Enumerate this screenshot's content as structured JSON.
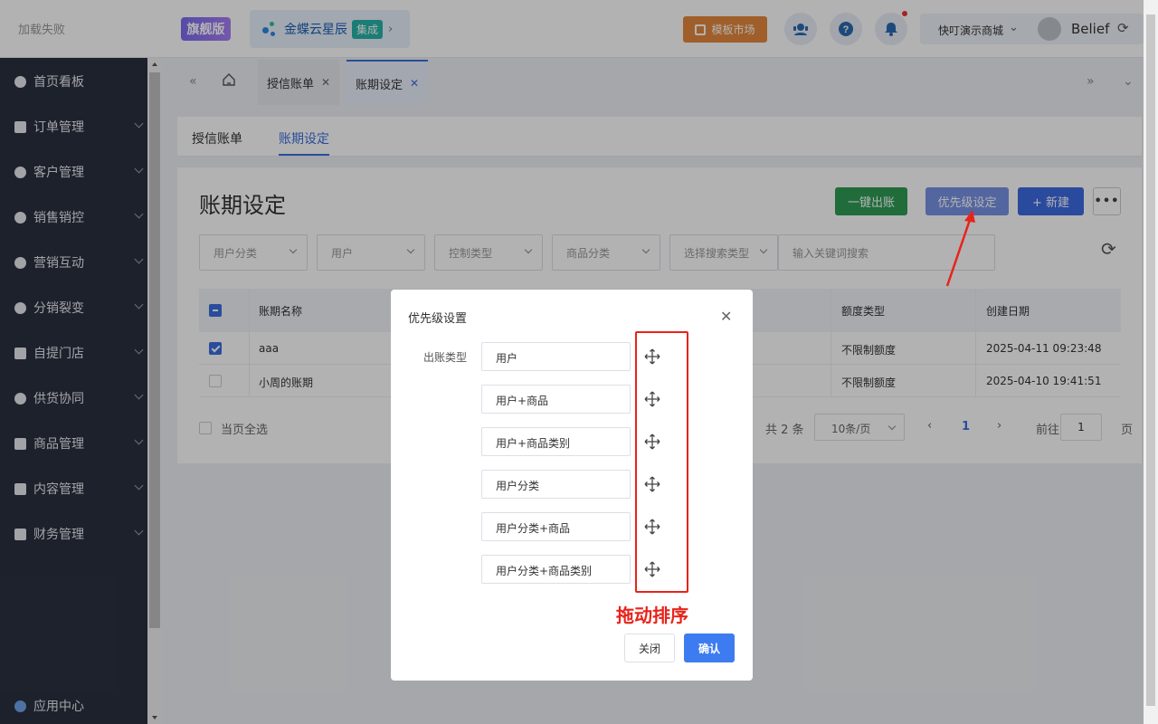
{
  "topbar": {
    "load_failed": "加载失败",
    "edition_badge": "旗舰版",
    "brand_name": "金蝶云星辰",
    "brand_tag": "集成",
    "template_market": "模板市场",
    "store_name": "快叮演示商城",
    "user_name": "Belief"
  },
  "sidebar": {
    "items": [
      {
        "label": "首页看板",
        "icon": "dashboard-icon"
      },
      {
        "label": "订单管理",
        "icon": "order-icon"
      },
      {
        "label": "客户管理",
        "icon": "customer-icon"
      },
      {
        "label": "销售销控",
        "icon": "sales-icon"
      },
      {
        "label": "营销互动",
        "icon": "marketing-icon"
      },
      {
        "label": "分销裂变",
        "icon": "distribution-icon"
      },
      {
        "label": "自提门店",
        "icon": "store-icon"
      },
      {
        "label": "供货协同",
        "icon": "supply-icon"
      },
      {
        "label": "商品管理",
        "icon": "product-icon"
      },
      {
        "label": "内容管理",
        "icon": "content-icon"
      },
      {
        "label": "财务管理",
        "icon": "finance-icon"
      }
    ],
    "app_center": "应用中心"
  },
  "tabs": [
    {
      "label": "授信账单"
    },
    {
      "label": "账期设定"
    }
  ],
  "subtabs": [
    {
      "label": "授信账单"
    },
    {
      "label": "账期设定"
    }
  ],
  "page": {
    "title": "账期设定",
    "btn_one_click": "一键出账",
    "btn_priority": "优先级设定",
    "btn_new": "+ 新建",
    "filters": [
      "用户分类",
      "用户",
      "控制类型",
      "商品分类",
      "选择搜索类型"
    ],
    "search_placeholder": "输入关键词搜索"
  },
  "table": {
    "headers": {
      "name": "账期名称",
      "limit_type": "额度类型",
      "created": "创建日期"
    },
    "rows": [
      {
        "name": "aaa",
        "limit_type": "不限制额度",
        "created": "2025-04-11 09:23:48"
      },
      {
        "name": "小周的账期",
        "limit_type": "不限制额度",
        "created": "2025-04-10 19:41:51"
      }
    ],
    "select_all_page": "当页全选",
    "total": "共 2 条",
    "page_size": "10条/页",
    "current_page": "1",
    "goto_label": "前往",
    "goto_value": "1",
    "page_unit": "页"
  },
  "modal": {
    "title": "优先级设置",
    "field_label": "出账类型",
    "priorities": [
      "用户",
      "用户+商品",
      "用户+商品类别",
      "用户分类",
      "用户分类+商品",
      "用户分类+商品类别"
    ],
    "drag_note": "拖动排序",
    "close_label": "关闭",
    "confirm_label": "确认"
  },
  "colors": {
    "primary": "#3c6fe0",
    "sidebar_bg": "#2a3040",
    "annotation_red": "#e8231b",
    "green_button": "#2f9d55",
    "market_orange": "#e6893d"
  }
}
